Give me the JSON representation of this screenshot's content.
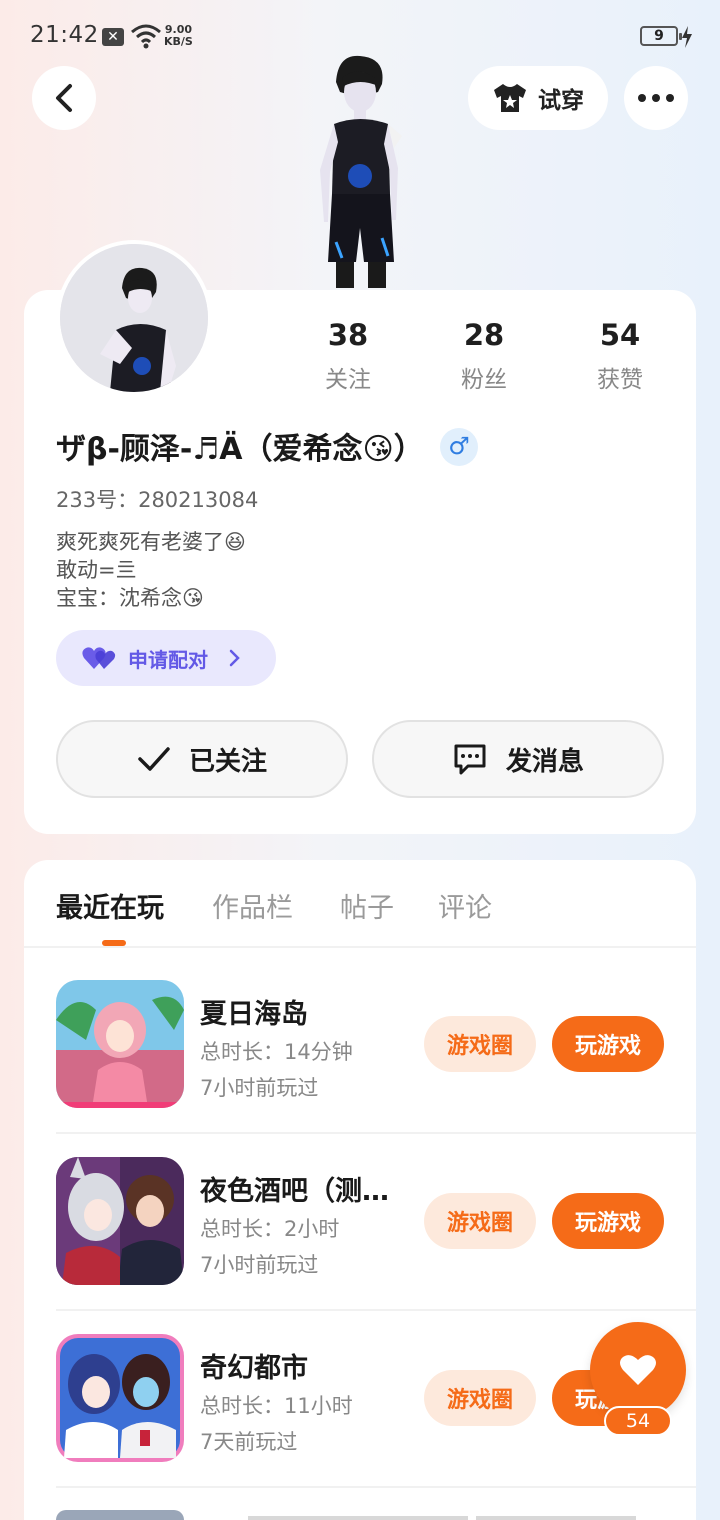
{
  "status_bar": {
    "time": "21:42",
    "speed_value": "9.00",
    "speed_unit": "KB/S",
    "battery": "9"
  },
  "header": {
    "tryon_label": "试穿"
  },
  "profile": {
    "stats": [
      {
        "value": "38",
        "label": "关注"
      },
      {
        "value": "28",
        "label": "粉丝"
      },
      {
        "value": "54",
        "label": "获赞"
      }
    ],
    "username": "ザβ-顾泽-♬Ä（爱希念😘）",
    "gender_symbol": "♂",
    "uid_line": "233号：280213084",
    "bio_lines": [
      "爽死爽死有老婆了😆",
      "敢动=亖",
      "宝宝：沈希念😘"
    ],
    "pair_label": "申请配对",
    "follow_label": "已关注",
    "message_label": "发消息"
  },
  "tabs": [
    {
      "label": "最近在玩",
      "active": true
    },
    {
      "label": "作品栏",
      "active": false
    },
    {
      "label": "帖子",
      "active": false
    },
    {
      "label": "评论",
      "active": false
    }
  ],
  "games": [
    {
      "title": "夏日海岛",
      "duration": "总时长：14分钟",
      "last_played": "7小时前玩过",
      "circle_label": "游戏圈",
      "play_label": "玩游戏"
    },
    {
      "title": "夜色酒吧（测…",
      "duration": "总时长：2小时",
      "last_played": "7小时前玩过",
      "circle_label": "游戏圈",
      "play_label": "玩游戏"
    },
    {
      "title": "奇幻都市",
      "duration": "总时长：11小时",
      "last_played": "7天前玩过",
      "circle_label": "游戏圈",
      "play_label": "玩游戏"
    }
  ],
  "floating_like": {
    "count": "54"
  },
  "colors": {
    "accent": "#f56b18",
    "pair_purple": "#6359e6",
    "gender_blue": "#2f7de1"
  }
}
